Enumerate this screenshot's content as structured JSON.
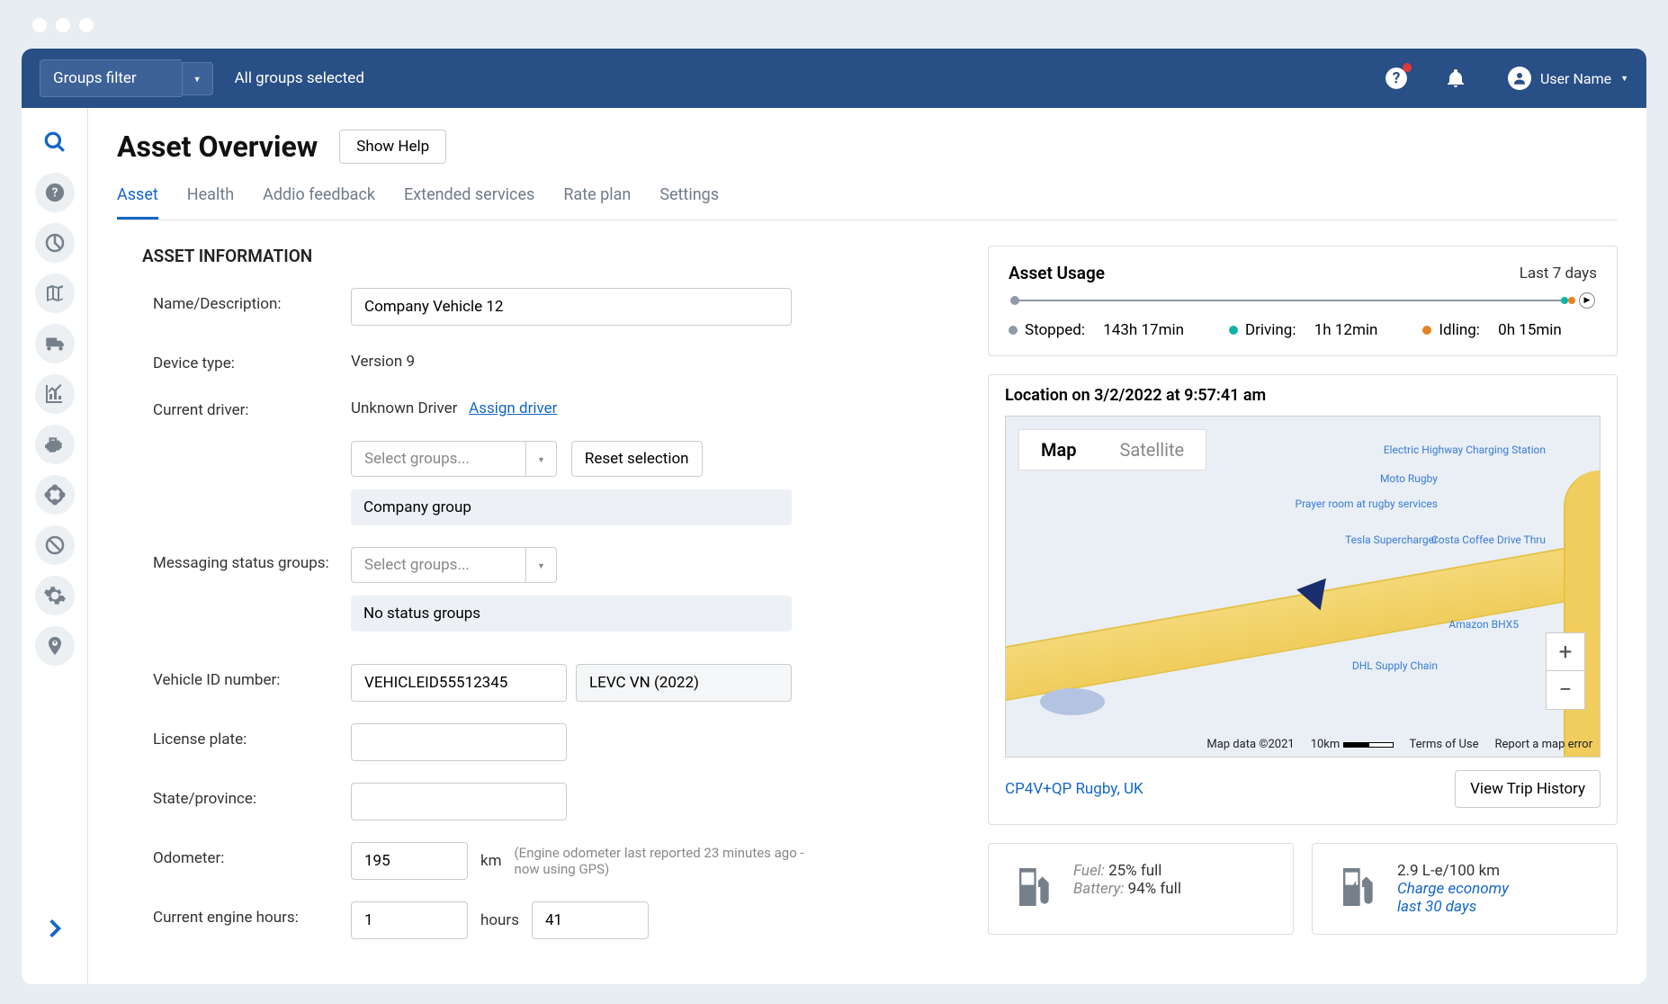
{
  "header": {
    "groups_filter_label": "Groups filter",
    "all_groups_selected": "All groups selected",
    "user_name": "User Name"
  },
  "page": {
    "title": "Asset Overview",
    "show_help": "Show Help"
  },
  "tabs": [
    {
      "label": "Asset",
      "active": true
    },
    {
      "label": "Health"
    },
    {
      "label": "Addio feedback"
    },
    {
      "label": "Extended services"
    },
    {
      "label": "Rate plan"
    },
    {
      "label": "Settings"
    }
  ],
  "asset_info": {
    "section_title": "ASSET INFORMATION",
    "labels": {
      "name": "Name/Description:",
      "device_type": "Device type:",
      "current_driver": "Current driver:",
      "messaging_status": "Messaging status groups:",
      "vehicle_id": "Vehicle ID number:",
      "license_plate": "License plate:",
      "state_province": "State/province:",
      "odometer": "Odometer:",
      "engine_hours": "Current engine hours:"
    },
    "values": {
      "name": "Company Vehicle 12",
      "device_type": "Version 9",
      "current_driver": "Unknown Driver",
      "assign_driver_link": "Assign driver",
      "select_groups_placeholder": "Select groups...",
      "reset_selection": "Reset selection",
      "company_group_chip": "Company group",
      "no_status_groups_chip": "No status groups",
      "vehicle_id": "VEHICLEID55512345",
      "vehicle_model": "LEVC VN (2022)",
      "license_plate": "",
      "state_province": "",
      "odometer": "195",
      "odometer_unit": "km",
      "odometer_note": "(Engine odometer last reported 23 minutes ago - now using GPS)",
      "engine_hours_val": "1",
      "engine_hours_unit": "hours",
      "engine_hours_min": "41"
    }
  },
  "usage": {
    "title": "Asset Usage",
    "period": "Last 7 days",
    "legend": {
      "stopped_label": "Stopped:",
      "stopped_value": "143h 17min",
      "driving_label": "Driving:",
      "driving_value": "1h 12min",
      "idling_label": "Idling:",
      "idling_value": "0h 15min"
    }
  },
  "location": {
    "title": "Location on 3/2/2022 at 9:57:41 am",
    "map_tab": "Map",
    "satellite_tab": "Satellite",
    "attribution": "Map data ©2021",
    "scale": "10km",
    "terms": "Terms of Use",
    "report": "Report a map error",
    "coords": "CP4V+QP Rugby, UK",
    "trip_history": "View Trip History",
    "pois": {
      "p1": "Electric Highway Charging Station",
      "p2": "Moto Rugby",
      "p3": "Prayer room at rugby services",
      "p4": "Tesla Supercharger",
      "p5": "Costa Coffee Drive Thru",
      "p6": "Amazon BHX5",
      "p7": "DHL Supply Chain"
    }
  },
  "stats": {
    "fuel_label": "Fuel:",
    "fuel_value": "25% full",
    "battery_label": "Battery:",
    "battery_value": "94% full",
    "economy_value": "2.9 L-e/100 km",
    "economy_label": "Charge economy",
    "economy_period": "last 30 days"
  }
}
